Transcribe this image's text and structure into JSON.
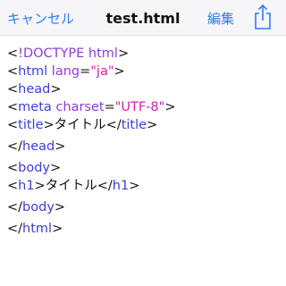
{
  "navbar": {
    "cancel_label": "キャンセル",
    "title": "test.html",
    "edit_label": "編集",
    "share_icon": "share-icon"
  },
  "editor": {
    "lines": [
      {
        "parts": [
          {
            "t": "<",
            "c": ""
          },
          {
            "t": "!DOCTYPE html",
            "c": "doctype"
          },
          {
            "t": ">",
            "c": ""
          }
        ]
      },
      {
        "parts": [
          {
            "t": "<",
            "c": ""
          },
          {
            "t": "html",
            "c": "tag"
          },
          {
            "t": " lang",
            "c": "attr"
          },
          {
            "t": "=",
            "c": ""
          },
          {
            "t": "\"ja\"",
            "c": "str"
          },
          {
            "t": ">",
            "c": ""
          }
        ]
      },
      {
        "parts": [
          {
            "t": "<",
            "c": ""
          },
          {
            "t": "head",
            "c": "tag"
          },
          {
            "t": ">",
            "c": ""
          }
        ]
      },
      {
        "parts": [
          {
            "t": "<",
            "c": ""
          },
          {
            "t": "meta",
            "c": "tag"
          },
          {
            "t": " charset",
            "c": "attr"
          },
          {
            "t": "=",
            "c": ""
          },
          {
            "t": "\"UTF-8\"",
            "c": "str"
          },
          {
            "t": ">",
            "c": ""
          }
        ]
      },
      {
        "parts": [
          {
            "t": "<",
            "c": ""
          },
          {
            "t": "title",
            "c": "tag"
          },
          {
            "t": ">タイトル</",
            "c": ""
          },
          {
            "t": "title",
            "c": "tag"
          },
          {
            "t": ">",
            "c": ""
          }
        ],
        "gap_after": true
      },
      {
        "parts": [
          {
            "t": "</",
            "c": ""
          },
          {
            "t": "head",
            "c": "tag"
          },
          {
            "t": ">",
            "c": ""
          }
        ],
        "gap_after": true
      },
      {
        "parts": [
          {
            "t": "<",
            "c": ""
          },
          {
            "t": "body",
            "c": "tag"
          },
          {
            "t": ">",
            "c": ""
          }
        ]
      },
      {
        "parts": [
          {
            "t": "<",
            "c": ""
          },
          {
            "t": "h1",
            "c": "tag"
          },
          {
            "t": ">タイトル</",
            "c": ""
          },
          {
            "t": "h1",
            "c": "tag"
          },
          {
            "t": ">",
            "c": ""
          }
        ],
        "gap_after": true
      },
      {
        "parts": [
          {
            "t": "</",
            "c": ""
          },
          {
            "t": "body",
            "c": "tag"
          },
          {
            "t": ">",
            "c": ""
          }
        ],
        "gap_after": true
      },
      {
        "parts": [
          {
            "t": "</",
            "c": ""
          },
          {
            "t": "html",
            "c": "tag"
          },
          {
            "t": ">",
            "c": ""
          }
        ]
      }
    ]
  },
  "colors": {
    "accent": "#2f7cf6",
    "tag": "#3d3ddb",
    "attribute": "#8b3dd6",
    "string": "#d31fb0"
  }
}
